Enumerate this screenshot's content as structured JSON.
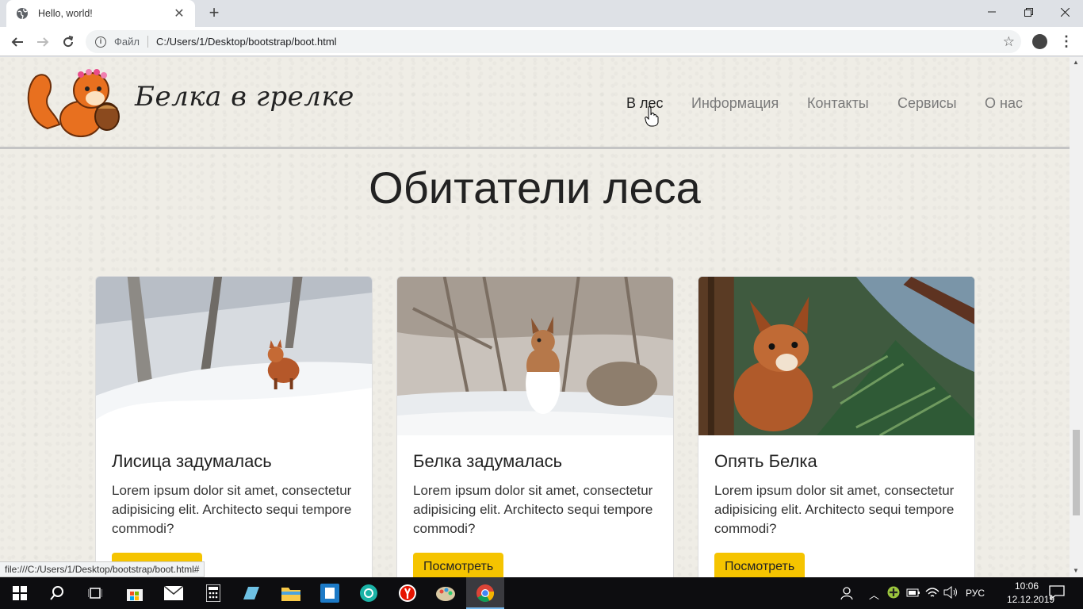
{
  "browser": {
    "tab_title": "Hello, world!",
    "tab_close": "✕",
    "new_tab": "+",
    "scheme_label": "Файл",
    "url": "C:/Users/1/Desktop/bootstrap/boot.html",
    "status_url": "file:///C:/Users/1/Desktop/bootstrap/boot.html#"
  },
  "site": {
    "brand": "Белка в грелке",
    "nav": [
      {
        "label": "В лес",
        "active": true
      },
      {
        "label": "Информация"
      },
      {
        "label": "Контакты"
      },
      {
        "label": "Сервисы"
      },
      {
        "label": "О нас"
      }
    ],
    "heading": "Обитатели леса",
    "cards": [
      {
        "title": "Лисица задумалась",
        "text": "Lorem ipsum dolor sit amet, consectetur adipisicing elit. Architecto sequi tempore commodi?",
        "button": "Посмотреть",
        "image": "fox-in-snow"
      },
      {
        "title": "Белка задумалась",
        "text": "Lorem ipsum dolor sit amet, consectetur adipisicing elit. Architecto sequi tempore commodi?",
        "button": "Посмотреть",
        "image": "squirrel-in-snow"
      },
      {
        "title": "Опять Белка",
        "text": "Lorem ipsum dolor sit amet, consectetur adipisicing elit. Architecto sequi tempore commodi?",
        "button": "Посмотреть",
        "image": "squirrel-on-tree"
      }
    ],
    "accent": "#f5c400"
  },
  "taskbar": {
    "lang": "РУС",
    "time": "10:06",
    "date": "12.12.2019"
  }
}
